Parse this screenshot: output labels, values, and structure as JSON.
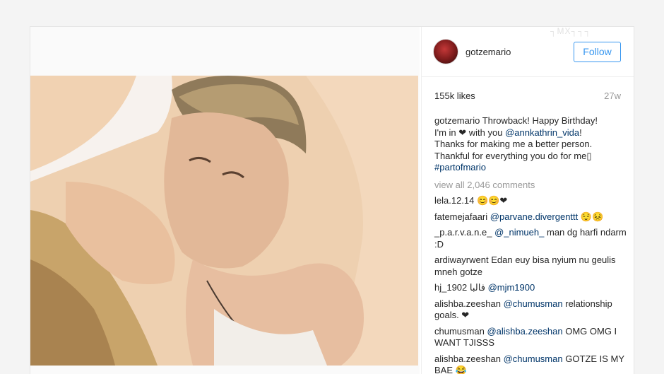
{
  "post": {
    "username": "gotzemario",
    "follow_label": "Follow",
    "watermark": "┐MX┐┐┐",
    "likes": "155k likes",
    "age": "27w",
    "caption": {
      "user": "gotzemario",
      "line1": "Throwback! Happy Birthday!",
      "line2_before": "I'm in ❤ with you ",
      "line2_mention": "@annkathrin_vida",
      "line2_after": "!",
      "line3": "Thanks for making me a better person.",
      "line4": "Thankful for everything you do for me▯",
      "hashtag": "#partofmario"
    },
    "view_all": "view all 2,046 comments",
    "comments": [
      {
        "user": "lela.12.14",
        "text": "😊😊❤"
      },
      {
        "user": "fatemejafaari",
        "mention": "@parvane.divergenttt",
        "text": "😌😣"
      },
      {
        "user": "_p.a.r.v.a.n.e_",
        "mention": "@_nimueh_",
        "text": "man dg harfi ndarm :D"
      },
      {
        "user": "ardiwayrwent",
        "text": "Edan euy bisa nyium nu geulis mneh gotze"
      },
      {
        "user": "hj_1902",
        "text": "فالبا",
        "mention": "@mjm1900"
      },
      {
        "user": "alishba.zeeshan",
        "mention": "@chumusman",
        "text": "relationship goals. ❤"
      },
      {
        "user": "chumusman",
        "mention": "@alishba.zeeshan",
        "text": "OMG OMG I WANT TJISSS"
      },
      {
        "user": "alishba.zeeshan",
        "mention": "@chumusman",
        "text": "GOTZE IS MY BAE 😂"
      }
    ]
  },
  "colors": {
    "link": "#003569",
    "follow": "#3897f0",
    "muted": "#999999"
  }
}
